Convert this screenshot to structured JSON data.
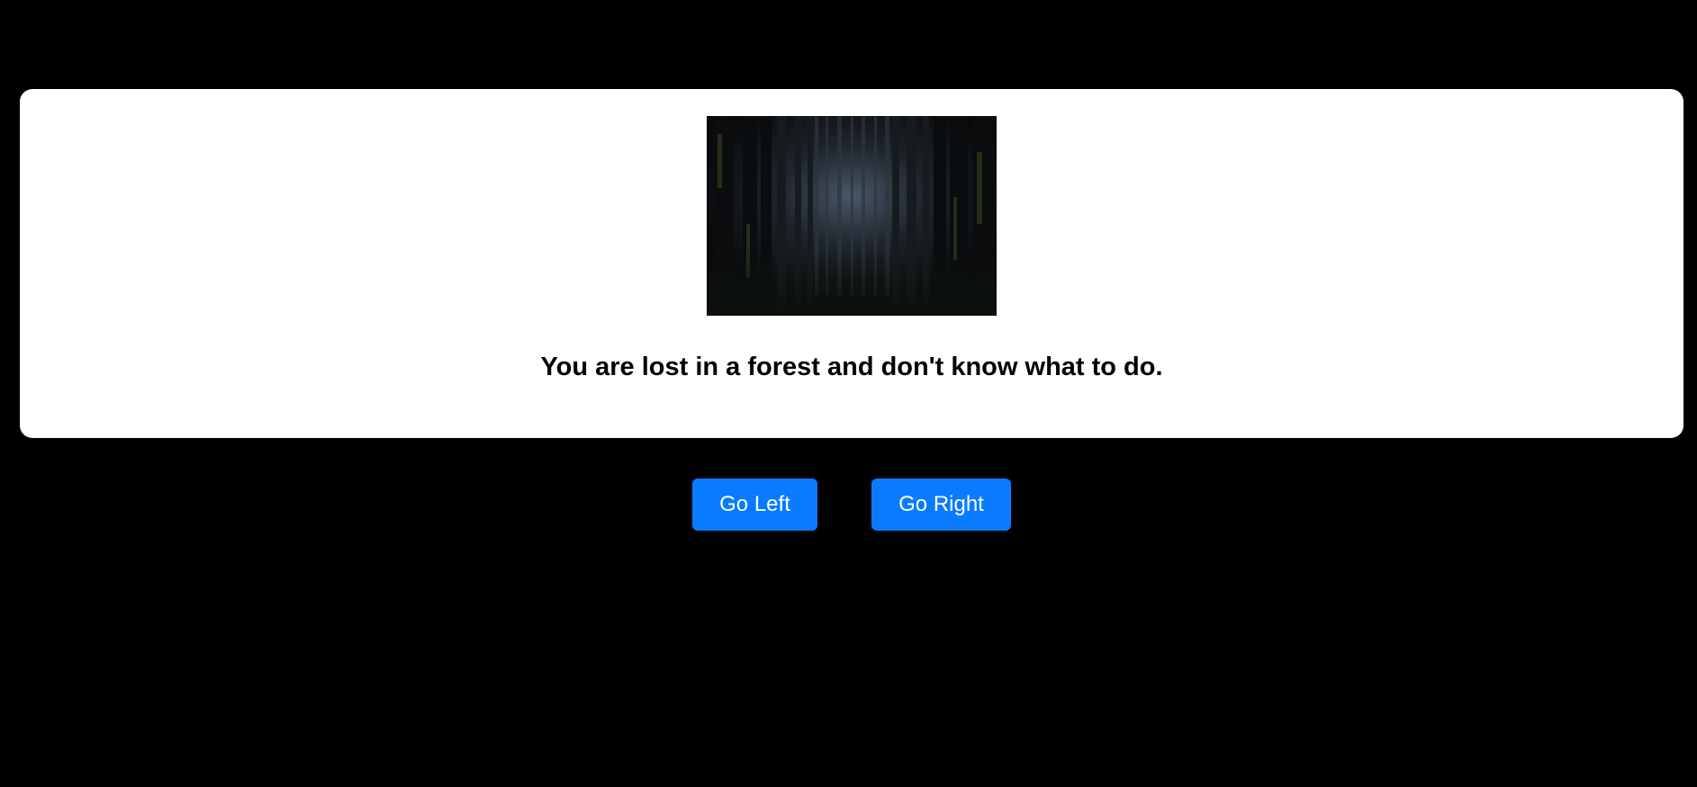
{
  "scene": {
    "image_icon": "dark-forest-image",
    "text": "You are lost in a forest and don't know what to do."
  },
  "choices": {
    "left_label": "Go Left",
    "right_label": "Go Right"
  },
  "colors": {
    "background": "#000000",
    "card": "#ffffff",
    "button": "#0a7bff",
    "button_text": "#ffffff"
  }
}
